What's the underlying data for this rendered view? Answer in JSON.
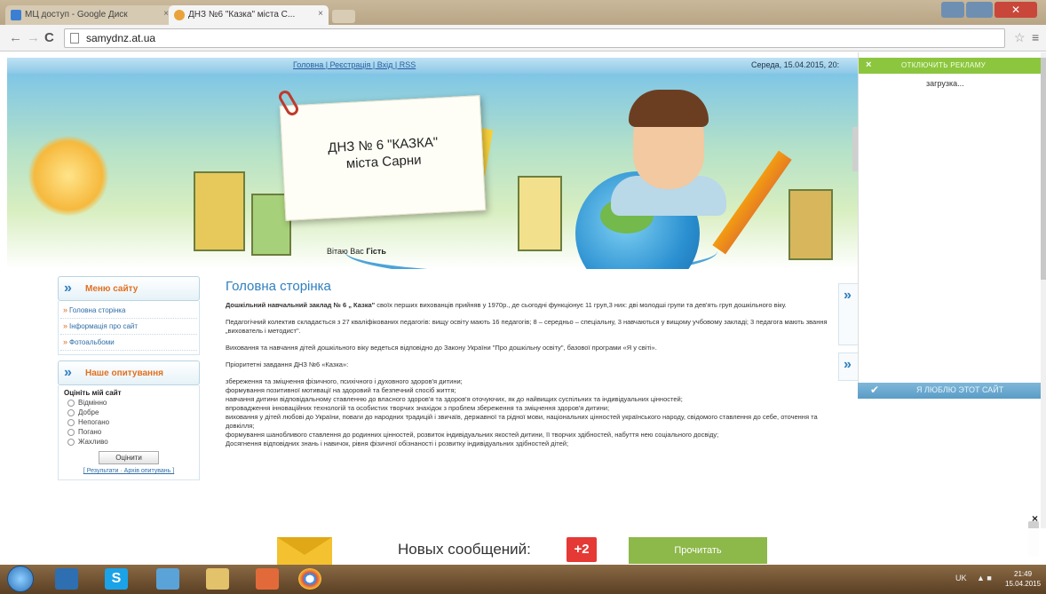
{
  "browser": {
    "tabs": [
      {
        "label": "МЦ доступ - Google Диск"
      },
      {
        "label": "ДНЗ №6 \"Казка\" міста С..."
      }
    ],
    "address": "samydnz.at.ua",
    "tab_close_glyph": "×"
  },
  "site": {
    "top_links": "Головна | Реєстрація | Вхід | RSS",
    "date_line": "Середа, 15.04.2015, 20:",
    "title_line1": "ДНЗ № 6 \"КАЗКА\"",
    "title_line2": "міста Сарни",
    "welcome_prefix": "Вітаю Вас",
    "welcome_user": "Гість"
  },
  "sidebar": {
    "menu_title": "Меню сайту",
    "menu_items": [
      {
        "label": "Головна сторінка"
      },
      {
        "label": "Інформація про сайт"
      },
      {
        "label": "Фотоальбоми"
      }
    ],
    "poll_title": "Наше опитування",
    "poll_question": "Оцініть мій сайт",
    "poll_options": [
      {
        "label": "Відмінно"
      },
      {
        "label": "Добре"
      },
      {
        "label": "Непогано"
      },
      {
        "label": "Погано"
      },
      {
        "label": "Жахливо"
      }
    ],
    "poll_button": "Оцінити",
    "poll_links": "[ Результати · Архів опитувань ]"
  },
  "main": {
    "page_title": "Головна сторінка",
    "intro_bold": "Дошкільний навчальний заклад № 6 „ Казка\"",
    "intro_rest": " своїх перших вихованців прийняв у 1970р., де сьогодні функціонує 11 груп,3 них: дві молодші групи та дев'ять груп дошкільного віку.",
    "para2": "Педагогічний колектив складається з 27 кваліфікованих педагогів: вищу освіту мають 16 педагогів; 8 – середньо – спеціальну, 3 навчаються у вищому учбовому закладі; 3 педагога мають звання „вихователь і методист\".",
    "para3": "Виховання та навчання дітей дошкільного віку ведеться відповідно до Закону України \"Про дошкільну освіту\", базової програми «Я у світі».",
    "para4": "Пріоритетні завдання ДНЗ №6 «Казка»:",
    "tasks": [
      "збереження та зміцнення фізичного, психічного і духовного здоров'я дитини;",
      "формування позитивної мотивації на здоровий та безпечний спосіб життя;",
      "навчання дитини відповідальному ставленню до власного здоров'я та здоров'я оточуючих, як до найвищих суспільних та індивідуальних цінностей;",
      "впровадження інноваційних технологій та особистих творчих знахідок з проблем збереження та зміцнення здоров'я дитини;",
      "виховання у дітей любові до України, поваги до народних традицій і звичаїв, державної та рідної мови, національних цінностей українського народу, свідомого ставлення до себе, оточення та довкілля;",
      "формування шанобливого ставлення до родинних цінностей, розвиток індивідуальних якостей дитини, її творчих здібностей, набуття нею соціального досвіду;",
      "Досягнення відповідних знань і навичок, рівня фізичної обізнаності і розвитку індивідуальних здібностей дітей;"
    ]
  },
  "ad_panel": {
    "close_glyph": "×",
    "top_label": "ОТКЛЮЧИТЬ РЕКЛАМУ",
    "loading": "загрузка...",
    "like_label": "Я ЛЮБЛЮ ЭТОТ САЙТ"
  },
  "message_bar": {
    "text": "Новых сообщений:",
    "count": "+2",
    "button": "Прочитать"
  },
  "taskbar": {
    "lang": "UK",
    "time": "21:49",
    "date": "15.04.2015"
  },
  "colors": {
    "accent_blue": "#2f7fbf",
    "menu_orange": "#e07020",
    "ad_green": "#8cc63f",
    "alert_red": "#e53935"
  }
}
